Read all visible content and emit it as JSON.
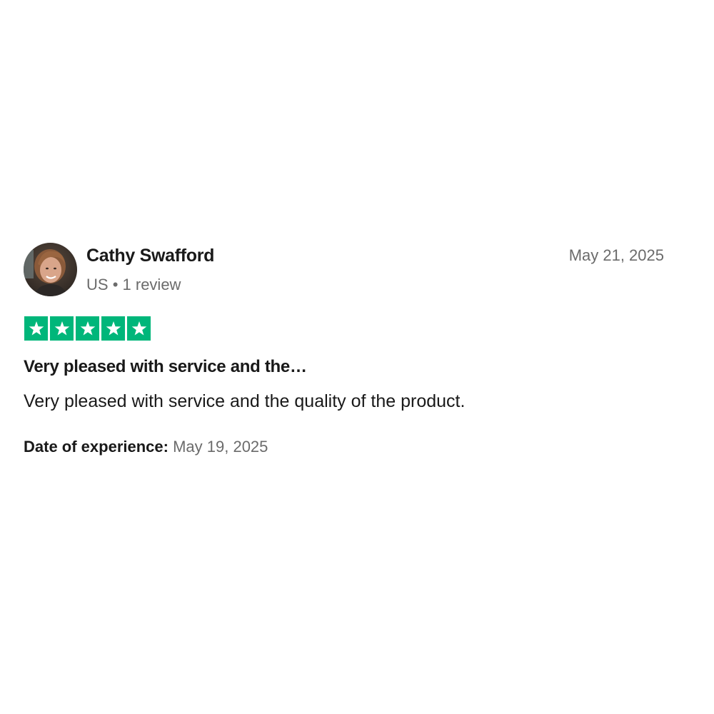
{
  "reviewer": {
    "name": "Cathy Swafford",
    "country": "US",
    "separator": "•",
    "review_count": "1 review"
  },
  "review": {
    "date": "May 21, 2025",
    "rating": 5,
    "rating_max": 5,
    "title": "Very pleased with service and the…",
    "body": "Very pleased with service and the quality of the product.",
    "experience_label": "Date of experience:",
    "experience_date": "May 19, 2025"
  },
  "colors": {
    "star_fill": "#00b67a",
    "name_text": "#191919",
    "muted_text": "#6b6b6b"
  },
  "icons": {
    "avatar": "user-photo-avatar",
    "star": "star-icon"
  }
}
